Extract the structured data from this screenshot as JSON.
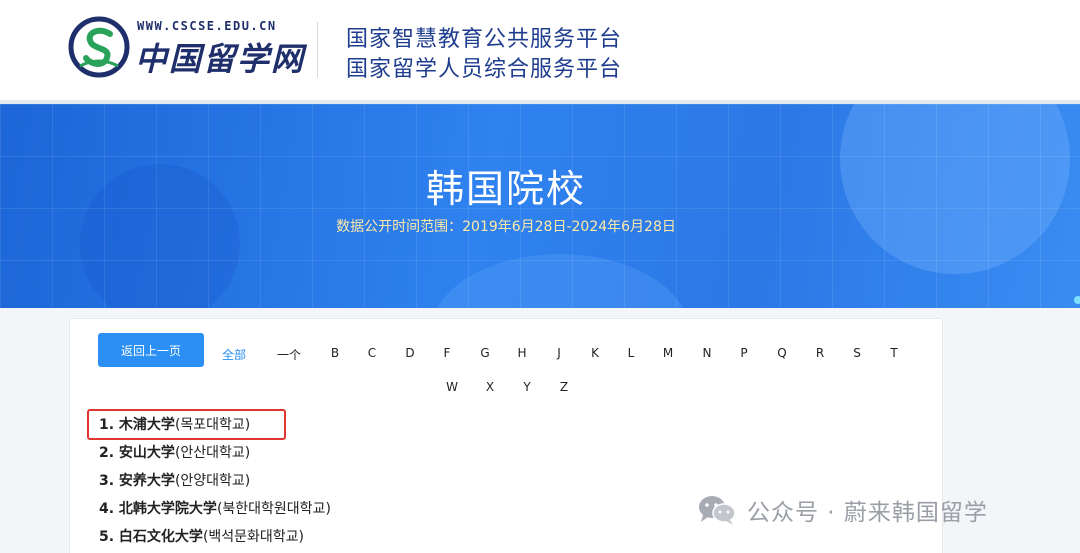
{
  "header": {
    "site_url": "WWW.CSCSE.EDU.CN",
    "site_name": "中国留学网",
    "platform_line1": "国家智慧教育公共服务平台",
    "platform_line2": "国家留学人员综合服务平台"
  },
  "banner": {
    "title": "韩国院校",
    "subtitle": "数据公开时间范围：2019年6月28日-2024年6月28日"
  },
  "filters": {
    "back_label": "返回上一页",
    "all_label": "全部",
    "letters": [
      "一个",
      "B",
      "C",
      "D",
      "F",
      "G",
      "H",
      "J",
      "K",
      "L",
      "M",
      "N",
      "P",
      "Q",
      "R",
      "S",
      "T",
      "W",
      "X",
      "Y",
      "Z"
    ]
  },
  "universities": [
    {
      "cn": "1. 木浦大学",
      "ko": "(목포대학교)"
    },
    {
      "cn": "2. 安山大学",
      "ko": "(안산대학교)"
    },
    {
      "cn": "3. 安养大学",
      "ko": "(안양대학교)"
    },
    {
      "cn": "4. 北韩大学院大学",
      "ko": "(북한대학원대학교)"
    },
    {
      "cn": "5. 白石文化大学",
      "ko": "(백석문화대학교)"
    }
  ],
  "watermark": {
    "text": "公众号 · 蔚来韩国留学"
  },
  "colors": {
    "accent": "#2b8ff3",
    "banner_blue": "#2f82ef",
    "highlight_red": "#e0362f",
    "logo_navy": "#1f2f6b"
  }
}
